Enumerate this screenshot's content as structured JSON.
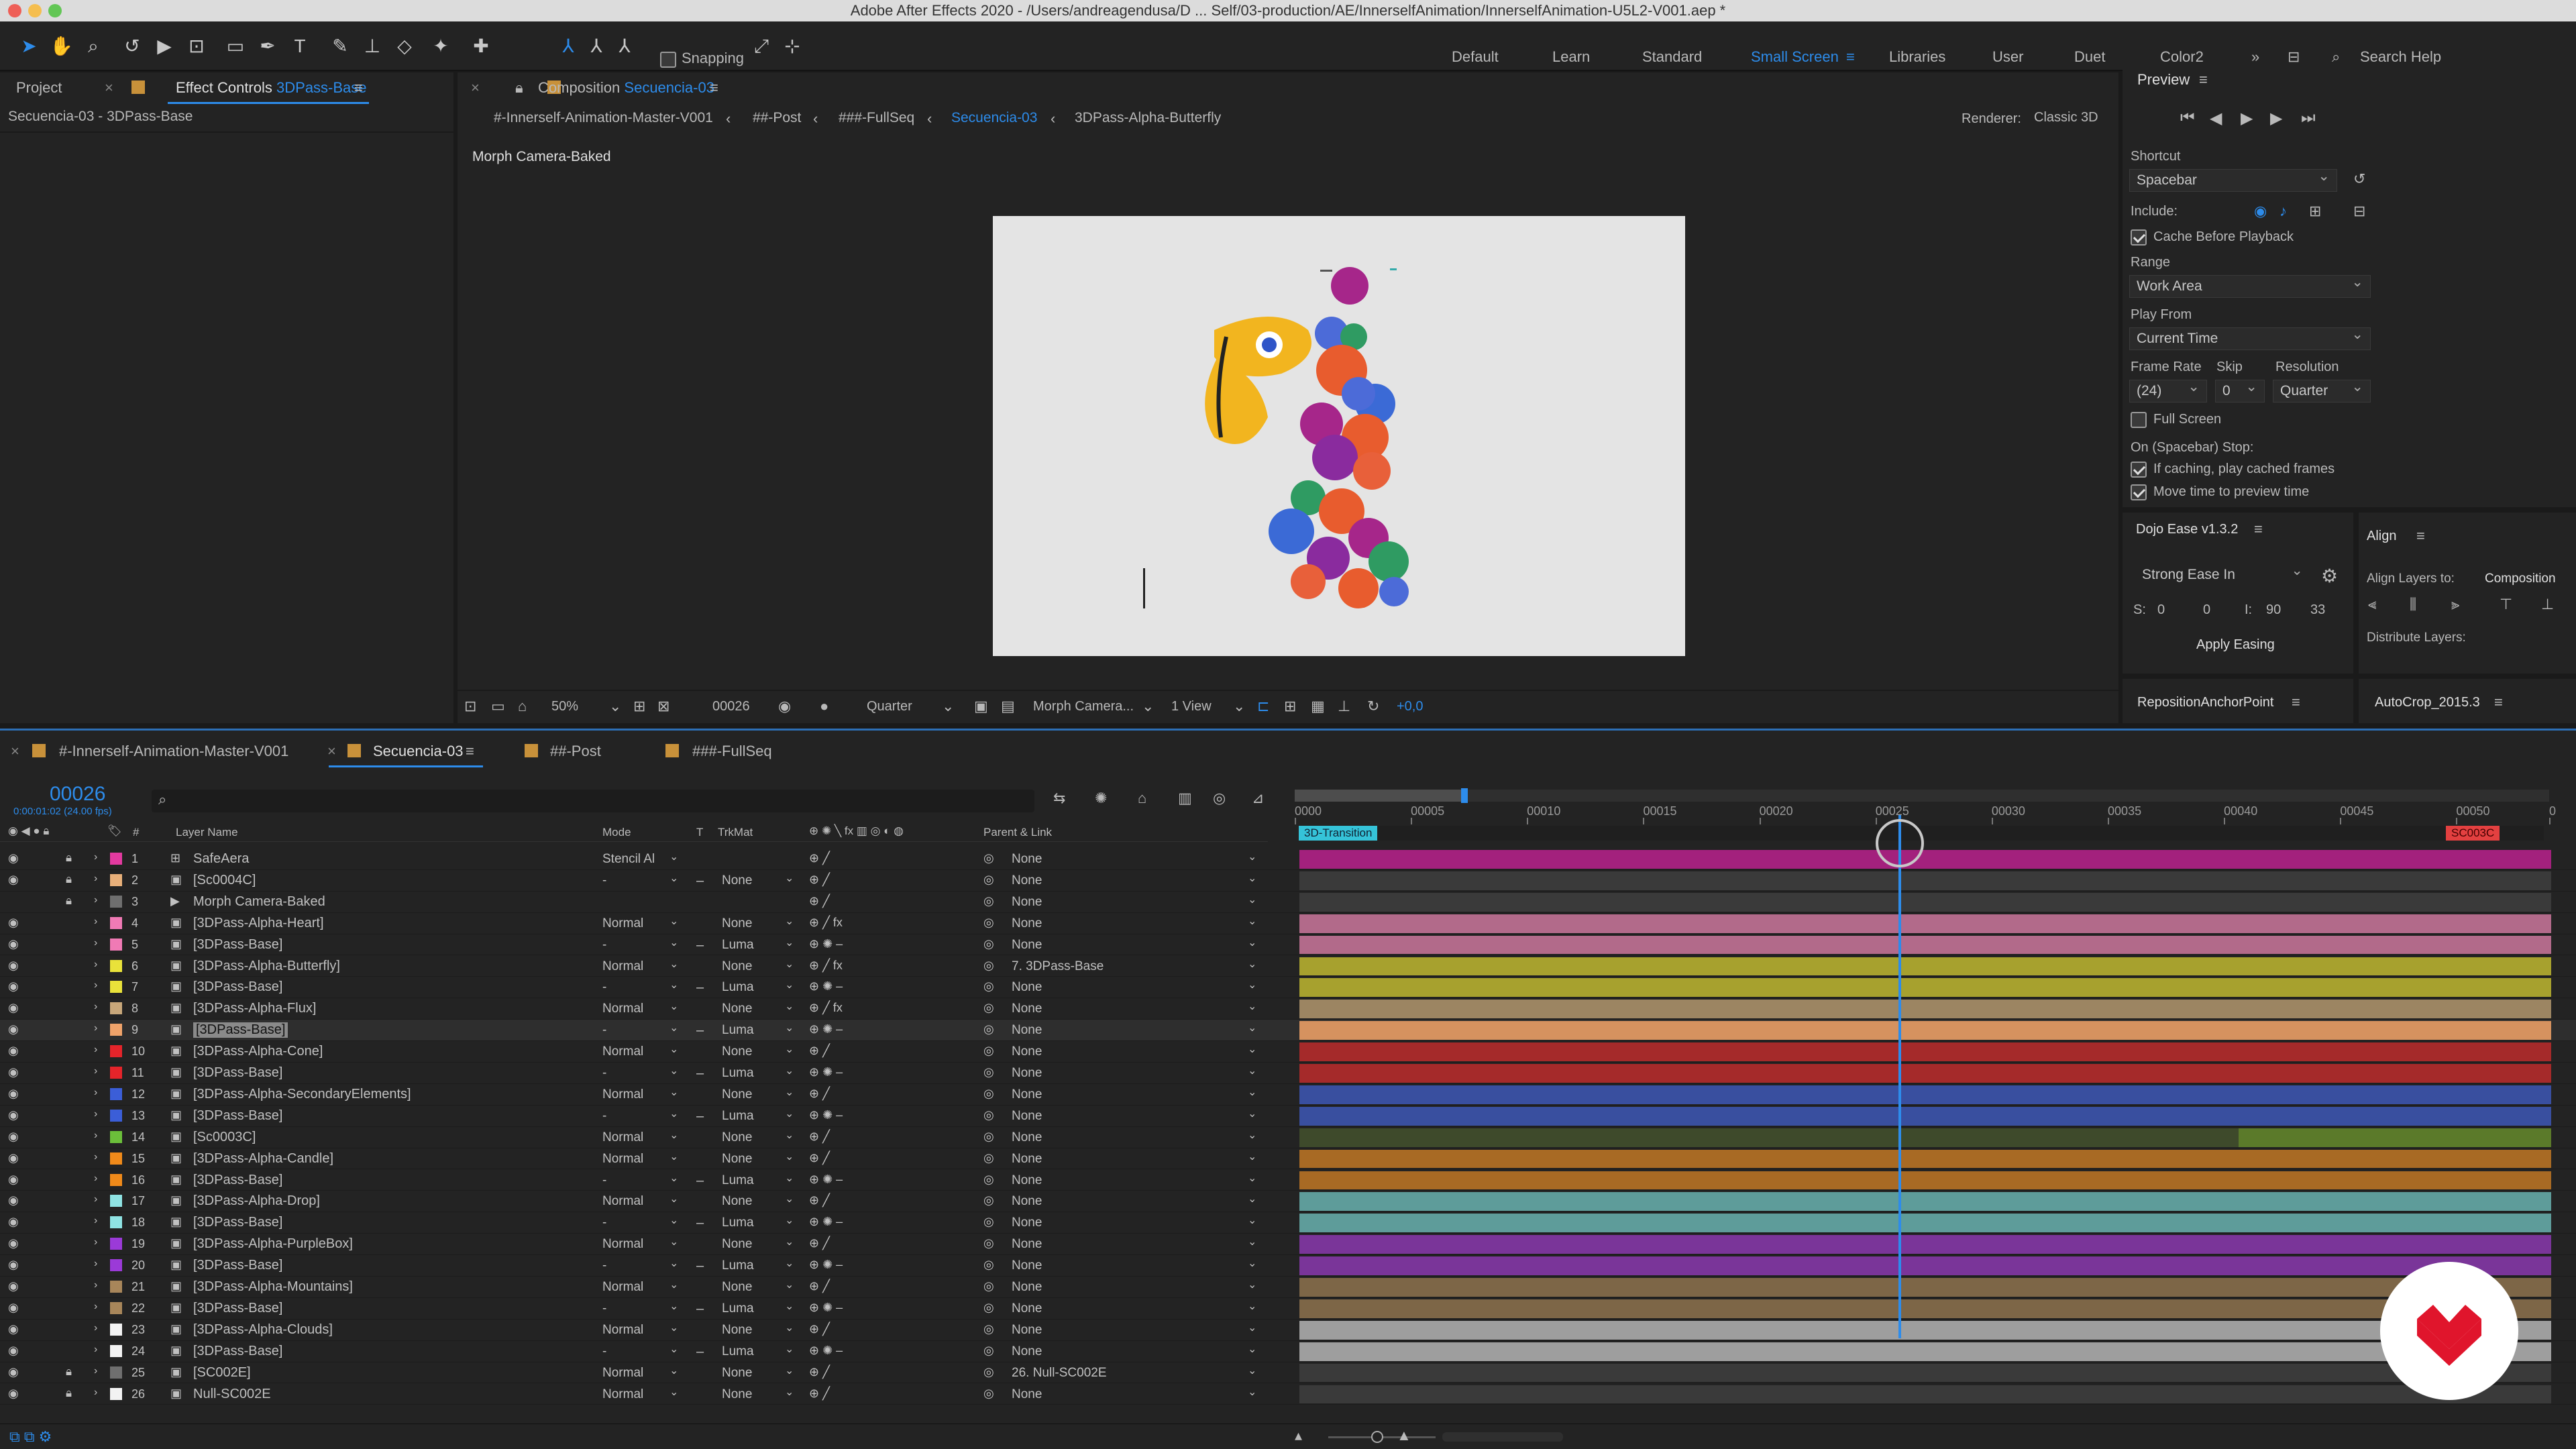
{
  "app": {
    "title": "Adobe After Effects 2020 - /Users/andreagendusa/D ... Self/03-production/AE/InnerselfAnimation/InnerselfAnimation-U5L2-V001.aep *"
  },
  "workspaces": [
    "Default",
    "Learn",
    "Standard",
    "Small Screen",
    "Libraries",
    "User",
    "Duet",
    "Color2"
  ],
  "search": {
    "placeholder": "Search Help"
  },
  "toolbar": {
    "snapping": "Snapping"
  },
  "left_panel": {
    "project_tab": "Project",
    "effect_controls_tab": "Effect Controls",
    "effect_controls_layer": "3DPass-Base",
    "breadcrumb": "Secuencia-03 - 3DPass-Base"
  },
  "composition": {
    "tab_label": "Composition",
    "tab_comp": "Secuencia-03",
    "breadcrumbs": [
      "#-Innerself-Animation-Master-V001",
      "##-Post",
      "###-FullSeq",
      "Secuencia-03",
      "3DPass-Alpha-Butterfly"
    ],
    "renderer_label": "Renderer:",
    "renderer": "Classic 3D",
    "layer_name": "Morph Camera-Baked",
    "zoom": "50%",
    "timecode": "00026",
    "resolution": "Quarter",
    "camera": "Morph Camera...",
    "views": "1 View",
    "exposure": "+0,0"
  },
  "preview": {
    "title": "Preview",
    "shortcut_label": "Shortcut",
    "shortcut": "Spacebar",
    "include_label": "Include:",
    "cache_before": "Cache Before Playback",
    "range_label": "Range",
    "range": "Work Area",
    "play_from_label": "Play From",
    "play_from": "Current Time",
    "frame_rate_label": "Frame Rate",
    "skip_label": "Skip",
    "resolution_label": "Resolution",
    "frame_rate": "(24)",
    "skip": "0",
    "resolution": "Quarter",
    "full_screen": "Full Screen",
    "stop_label": "On (Spacebar) Stop:",
    "if_caching": "If caching, play cached frames",
    "move_time": "Move time to preview time"
  },
  "dojo": {
    "title": "Dojo Ease v1.3.2",
    "ease": "Strong Ease In",
    "s_label": "S:",
    "s1": "0",
    "s2": "0",
    "i_label": "I:",
    "i1": "90",
    "i2": "33",
    "apply": "Apply Easing"
  },
  "align": {
    "title": "Align",
    "align_to_label": "Align Layers to:",
    "align_to": "Composition",
    "distribute": "Distribute Layers:"
  },
  "scripts": {
    "reposition": "RepositionAnchorPoint",
    "autocrop": "AutoCrop_2015.3"
  },
  "timeline": {
    "tabs": [
      "#-Innerself-Animation-Master-V001",
      "Secuencia-03",
      "##-Post",
      "###-FullSeq"
    ],
    "current_time": "00026",
    "current_time_sub": "0:00:01:02 (24.00 fps)",
    "headers": {
      "num": "#",
      "layer_name": "Layer Name",
      "mode": "Mode",
      "t": "T",
      "trkmat": "TrkMat",
      "parent": "Parent & Link"
    },
    "ticks": [
      "0000",
      "00005",
      "00010",
      "00015",
      "00020",
      "00025",
      "00030",
      "00035",
      "00040",
      "00045",
      "00050",
      "0"
    ],
    "marker_start": "3D-Transition",
    "marker_end": "SC003C",
    "playhead_frame": 26,
    "total_frames": 54
  },
  "layers": [
    {
      "n": "1",
      "name": "SafeAera",
      "mode": "Stencil Al",
      "trk": "",
      "parent": "None",
      "color": "#e33aa0",
      "bar": "#a3217d"
    },
    {
      "n": "2",
      "name": "[Sc0004C]",
      "mode": "-",
      "trk": "None",
      "parent": "None",
      "color": "#e8b07a",
      "bar": "#3a3a3a"
    },
    {
      "n": "3",
      "name": "Morph Camera-Baked",
      "mode": "",
      "trk": "",
      "parent": "None",
      "color": "#6f6f6f",
      "bar": "#3a3a3a"
    },
    {
      "n": "4",
      "name": "[3DPass-Alpha-Heart]",
      "mode": "Normal",
      "trk": "None",
      "parent": "None",
      "color": "#f07ab5",
      "bar": "#b26a8a"
    },
    {
      "n": "5",
      "name": "[3DPass-Base]",
      "mode": "-",
      "trk": "Luma",
      "parent": "None",
      "color": "#f07ab5",
      "bar": "#b26a8a"
    },
    {
      "n": "6",
      "name": "[3DPass-Alpha-Butterfly]",
      "mode": "Normal",
      "trk": "None",
      "parent": "7. 3DPass-Base",
      "color": "#e9e23a",
      "bar": "#a7a12e"
    },
    {
      "n": "7",
      "name": "[3DPass-Base]",
      "mode": "-",
      "trk": "Luma",
      "parent": "None",
      "color": "#e9e23a",
      "bar": "#a7a12e"
    },
    {
      "n": "8",
      "name": "[3DPass-Alpha-Flux]",
      "mode": "Normal",
      "trk": "None",
      "parent": "None",
      "color": "#c8a77a",
      "bar": "#9c8562"
    },
    {
      "n": "9",
      "name": "[3DPass-Base]",
      "mode": "-",
      "trk": "Luma",
      "parent": "None",
      "color": "#f0a36a",
      "bar": "#d6925f"
    },
    {
      "n": "10",
      "name": "[3DPass-Alpha-Cone]",
      "mode": "Normal",
      "trk": "None",
      "parent": "None",
      "color": "#e5242a",
      "bar": "#a52a2a"
    },
    {
      "n": "11",
      "name": "[3DPass-Base]",
      "mode": "-",
      "trk": "Luma",
      "parent": "None",
      "color": "#e5242a",
      "bar": "#a52a2a"
    },
    {
      "n": "12",
      "name": "[3DPass-Alpha-SecondaryElements]",
      "mode": "Normal",
      "trk": "None",
      "parent": "None",
      "color": "#3b5ed8",
      "bar": "#394f9f"
    },
    {
      "n": "13",
      "name": "[3DPass-Base]",
      "mode": "-",
      "trk": "Luma",
      "parent": "None",
      "color": "#3b5ed8",
      "bar": "#394f9f"
    },
    {
      "n": "14",
      "name": "[Sc0003C]",
      "mode": "Normal",
      "trk": "None",
      "parent": "None",
      "color": "#6bbf3a",
      "bar": "#3e4a2b"
    },
    {
      "n": "15",
      "name": "[3DPass-Alpha-Candle]",
      "mode": "Normal",
      "trk": "None",
      "parent": "None",
      "color": "#f08a1a",
      "bar": "#a86a24"
    },
    {
      "n": "16",
      "name": "[3DPass-Base]",
      "mode": "-",
      "trk": "Luma",
      "parent": "None",
      "color": "#f08a1a",
      "bar": "#a86a24"
    },
    {
      "n": "17",
      "name": "[3DPass-Alpha-Drop]",
      "mode": "Normal",
      "trk": "None",
      "parent": "None",
      "color": "#8fe3e3",
      "bar": "#5e9c9a"
    },
    {
      "n": "18",
      "name": "[3DPass-Base]",
      "mode": "-",
      "trk": "Luma",
      "parent": "None",
      "color": "#8fe3e3",
      "bar": "#5e9c9a"
    },
    {
      "n": "19",
      "name": "[3DPass-Alpha-PurpleBox]",
      "mode": "Normal",
      "trk": "None",
      "parent": "None",
      "color": "#9b3ad8",
      "bar": "#7a3599"
    },
    {
      "n": "20",
      "name": "[3DPass-Base]",
      "mode": "-",
      "trk": "Luma",
      "parent": "None",
      "color": "#9b3ad8",
      "bar": "#7a3599"
    },
    {
      "n": "21",
      "name": "[3DPass-Alpha-Mountains]",
      "mode": "Normal",
      "trk": "None",
      "parent": "None",
      "color": "#a8865a",
      "bar": "#7d6647"
    },
    {
      "n": "22",
      "name": "[3DPass-Base]",
      "mode": "-",
      "trk": "Luma",
      "parent": "None",
      "color": "#a8865a",
      "bar": "#7d6647"
    },
    {
      "n": "23",
      "name": "[3DPass-Alpha-Clouds]",
      "mode": "Normal",
      "trk": "None",
      "parent": "None",
      "color": "#f2f2f2",
      "bar": "#9e9e9e"
    },
    {
      "n": "24",
      "name": "[3DPass-Base]",
      "mode": "-",
      "trk": "Luma",
      "parent": "None",
      "color": "#f2f2f2",
      "bar": "#9e9e9e"
    },
    {
      "n": "25",
      "name": "[SC002E]",
      "mode": "Normal",
      "trk": "None",
      "parent": "26. Null-SC002E",
      "color": "#6f6f6f",
      "bar": "#3a3a3a"
    },
    {
      "n": "26",
      "name": "Null-SC002E",
      "mode": "Normal",
      "trk": "None",
      "parent": "None",
      "color": "#f2f2f2",
      "bar": "#3a3a3a"
    }
  ],
  "colors": {
    "accent": "#2d8ceb",
    "panel": "#232323",
    "bg": "#1a1a1a"
  }
}
